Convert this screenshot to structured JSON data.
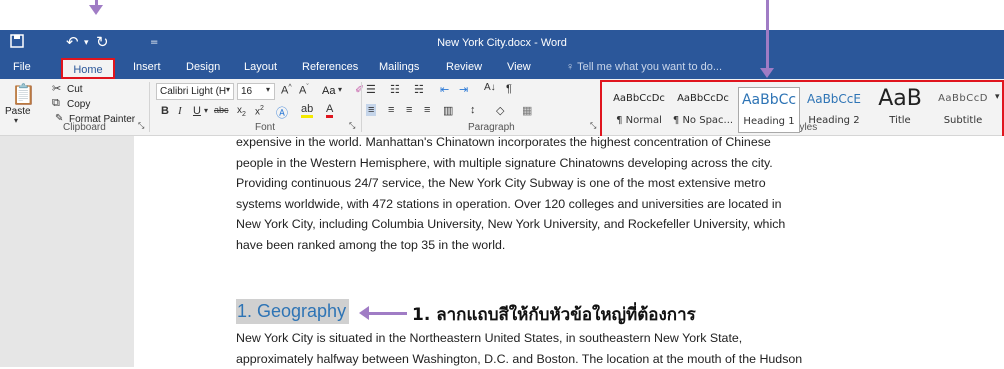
{
  "window": {
    "title": "New York City.docx - Word",
    "colors": {
      "title_bar": "#2b579a",
      "ribbon": "#f3f3f3",
      "annotation": "#a07cc5",
      "highlight_box": "#e0151e",
      "heading_text": "#2e74b5"
    }
  },
  "quick_access": {
    "save_icon": "save-icon",
    "undo_icon": "undo-icon",
    "redo_icon": "redo-icon",
    "customize_icon": "customize-icon"
  },
  "tabs": [
    "File",
    "Home",
    "Insert",
    "Design",
    "Layout",
    "References",
    "Mailings",
    "Review",
    "View"
  ],
  "active_tab": "Home",
  "tell_me": "Tell me what you want to do...",
  "clipboard": {
    "paste": "Paste",
    "cut": "Cut",
    "copy": "Copy",
    "format_painter": "Format Painter",
    "label": "Clipboard"
  },
  "font": {
    "name": "Calibri Light (H",
    "size": "16",
    "label": "Font",
    "change_case": "Aa"
  },
  "paragraph": {
    "label": "Paragraph"
  },
  "styles": {
    "label": "Styles",
    "items": [
      {
        "preview": "AaBbCcDc",
        "name": "¶ Normal"
      },
      {
        "preview": "AaBbCcDc",
        "name": "¶ No Spac..."
      },
      {
        "preview": "AaBbCc",
        "name": "Heading 1"
      },
      {
        "preview": "AaBbCcE",
        "name": "Heading 2"
      },
      {
        "preview": "AaB",
        "name": "Title"
      },
      {
        "preview": "AaBbCcD",
        "name": "Subtitle"
      }
    ],
    "selected": "Heading 1"
  },
  "document": {
    "lines_top": [
      "expensive in the world. Manhattan's Chinatown incorporates the highest concentration of Chinese",
      "people in the Western Hemisphere, with multiple signature Chinatowns developing across the city.",
      "Providing continuous 24/7 service, the New York City Subway is one of the most extensive metro",
      "systems worldwide, with 472 stations in operation. Over 120 colleges and universities are located in",
      "New York City, including Columbia University, New York University, and Rockefeller University, which",
      "have been ranked among the top 35 in the world."
    ],
    "heading": "1. Geography",
    "lines_bottom": [
      "New York City is situated in the Northeastern United States, in southeastern New York State,",
      "approximately halfway between Washington, D.C. and Boston. The location at the mouth of the Hudson"
    ]
  },
  "annotation": {
    "text": "1. ลากแถบสีให้กับหัวข้อใหญ่ที่ต้องการ"
  }
}
